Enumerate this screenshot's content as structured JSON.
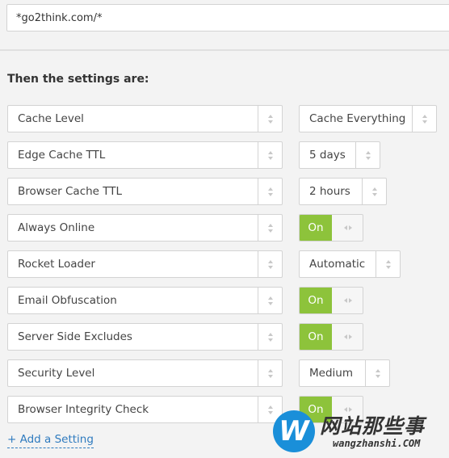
{
  "url_pattern": "*go2think.com/*",
  "heading": "Then the settings are:",
  "settings": [
    {
      "name": "Cache Level",
      "type": "select",
      "value": "Cache Everything"
    },
    {
      "name": "Edge Cache TTL",
      "type": "select",
      "value": "5 days"
    },
    {
      "name": "Browser Cache TTL",
      "type": "select",
      "value": "2 hours"
    },
    {
      "name": "Always Online",
      "type": "toggle",
      "value": "On"
    },
    {
      "name": "Rocket Loader",
      "type": "select",
      "value": "Automatic"
    },
    {
      "name": "Email Obfuscation",
      "type": "toggle",
      "value": "On"
    },
    {
      "name": "Server Side Excludes",
      "type": "toggle",
      "value": "On"
    },
    {
      "name": "Security Level",
      "type": "select",
      "value": "Medium"
    },
    {
      "name": "Browser Integrity Check",
      "type": "toggle",
      "value": "On"
    }
  ],
  "add_setting_label": "+ Add a Setting",
  "watermark": {
    "logo_letter": "W",
    "title": "网站那些事",
    "domain": "wangzhanshi.COM"
  },
  "colors": {
    "toggle_on": "#8dc33b",
    "link": "#2f7bbf"
  }
}
